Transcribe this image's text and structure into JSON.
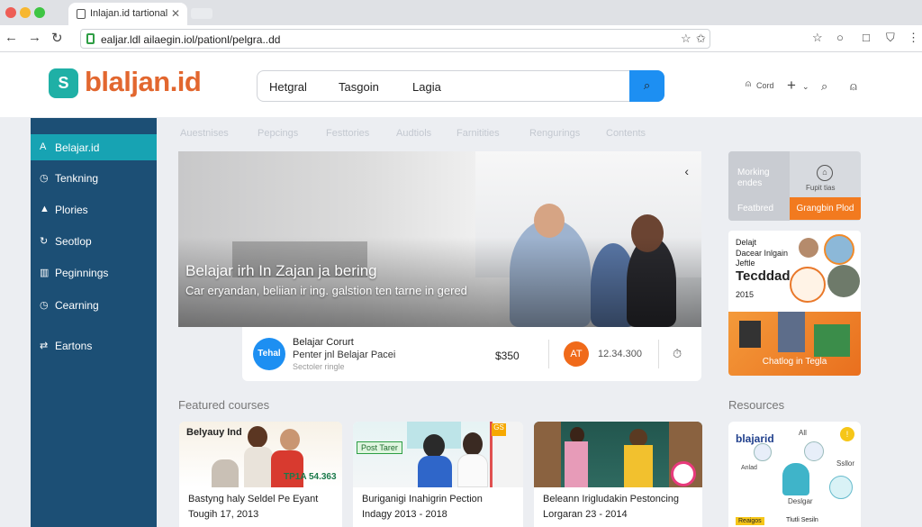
{
  "browser": {
    "tab_title": "Inlajan.id tartional",
    "tab_close": "✕",
    "url": "ealjar.ldl ailaegin.iol/pationl/pelgra..dd",
    "colors": {
      "close": "#ee5e56",
      "min": "#f7b730",
      "max": "#3ec543",
      "secure": "#2e9e44"
    }
  },
  "header": {
    "logo_mark": "S",
    "logo_text": "blaljan.id",
    "search_segments": [
      "Hetgral",
      "Tasgoin",
      "Lagia"
    ],
    "search_icon": "search-icon",
    "account_label": "Cord",
    "brand_color": "#e2672f",
    "accent_color": "#1d8ff2"
  },
  "sidebar": {
    "items": [
      {
        "icon": "A",
        "label": "Belajar.id",
        "active": true
      },
      {
        "icon": "◷",
        "label": "Tenkning"
      },
      {
        "icon": "▲",
        "label": "Plories"
      },
      {
        "icon": "↻",
        "label": "Seotlop"
      },
      {
        "icon": "▥",
        "label": "Peginnings"
      },
      {
        "icon": "◷",
        "label": "Cearning"
      },
      {
        "icon": "⇄",
        "label": "Eartons"
      }
    ],
    "color": "#1c4f75",
    "active_color": "#17a3b3"
  },
  "tabs": [
    "Auestnises",
    "Pepcings",
    "Festtories",
    "Audtiols",
    "Farnitities",
    "Rengurings",
    "Contents"
  ],
  "hero": {
    "title": "Belajar irh In Zajan ja bering",
    "subtitle": "Car eryandan, beliian ir ing. galstion ten tarne in gered",
    "arrow": "‹"
  },
  "info_bar": {
    "logo_text": "Tehal",
    "title": "Belajar Corurt",
    "line2": "Penter jnl Belajar Pacei",
    "line3": "Sectoler ringle",
    "price": "$350",
    "badge": "AT",
    "number": "12.34.300",
    "icon": "clock-icon"
  },
  "promo": {
    "line1": "Morking",
    "line2": "endes",
    "line3": "Featbred",
    "small": "Fupit tias",
    "button": "Grangbin Plod"
  },
  "side_card": {
    "line1": "Delajt",
    "line2": "Dacear Inlgain",
    "line3": "Jeftle",
    "title": "Tecddad",
    "year": "2015",
    "cta": "Chatlog in Tegla"
  },
  "featured": {
    "title": "Featured courses",
    "cards": [
      {
        "label": "Belyauy Ind",
        "tag": "TP1A 54.363",
        "line1": "Bastyng haly Seldel Pe Eyant",
        "line2": "Tougih 17, 2013"
      },
      {
        "label": "Post Tarer",
        "tag": "GS",
        "line1": "Buriganigi Inahigrin Pection",
        "line2": "Indagy 2013 - 2018"
      },
      {
        "label": "",
        "tag": "",
        "line1": "Beleann Irigludakin Pestoncing",
        "line2": "Lorgaran 23 - 2014"
      }
    ]
  },
  "resources": {
    "title": "Resources",
    "brand": "blajarid",
    "bits": [
      "All",
      "Ssllor",
      "Deslgar",
      "Anlad",
      "Reaigos",
      "Tlutli Sesiln"
    ]
  }
}
